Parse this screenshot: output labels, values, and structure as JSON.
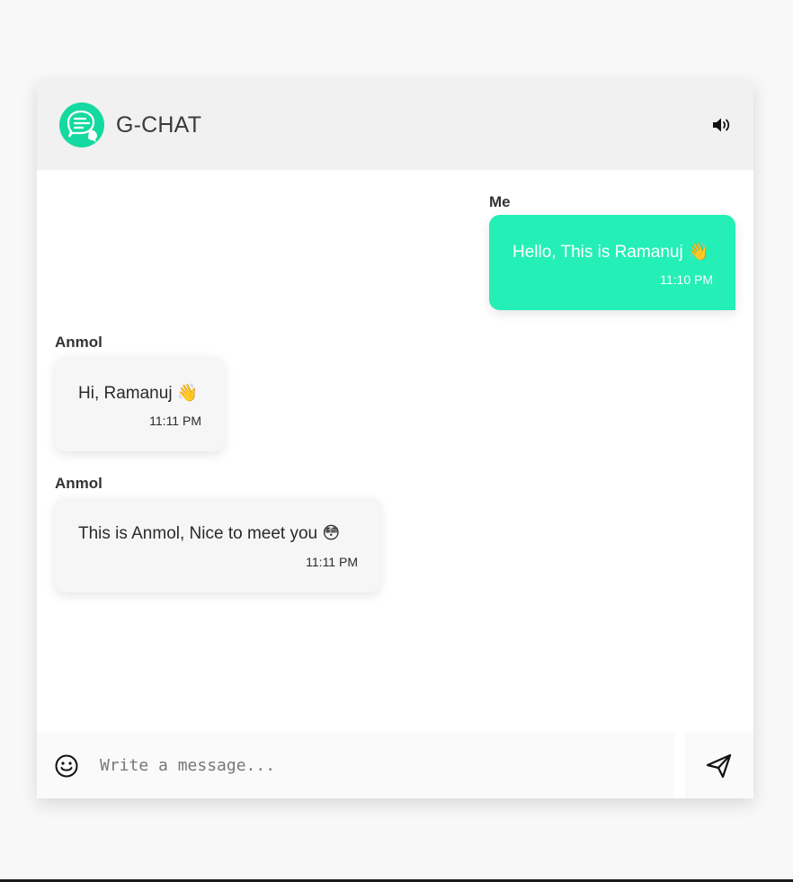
{
  "header": {
    "title": "G-CHAT",
    "logo_icon": "chat-bubbles-icon",
    "sound_icon": "volume-icon",
    "accent": "#15d9a0"
  },
  "messages": [
    {
      "sender": "Me",
      "text": "Hello, This is Ramanuj 👋",
      "time": "11:10 PM",
      "own": true,
      "bubble_color": "#24efb6"
    },
    {
      "sender": "Anmol",
      "text": "Hi, Ramanuj 👋",
      "time": "11:11 PM",
      "own": false,
      "bubble_color": "#f6f6f6"
    },
    {
      "sender": "Anmol",
      "text": "This is Anmol, Nice to meet you 😳",
      "time": "11:11 PM",
      "own": false,
      "bubble_color": "#f6f6f6"
    }
  ],
  "composer": {
    "placeholder": "Write a message...",
    "emoji_icon": "smiley-icon",
    "send_icon": "send-icon"
  }
}
